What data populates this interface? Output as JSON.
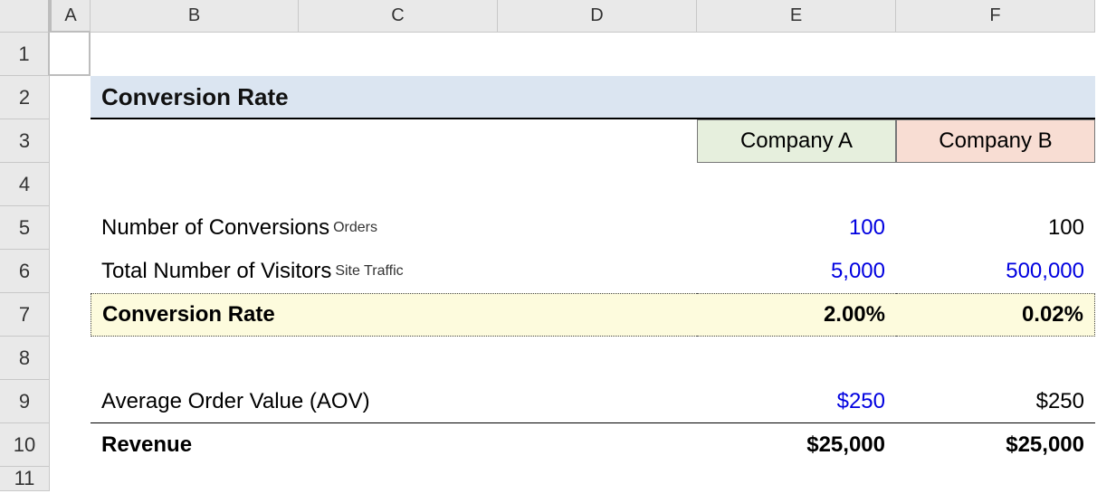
{
  "columns": [
    "A",
    "B",
    "C",
    "D",
    "E",
    "F"
  ],
  "rows": [
    "1",
    "2",
    "3",
    "4",
    "5",
    "6",
    "7",
    "8",
    "9",
    "10",
    "11"
  ],
  "title": "Conversion Rate",
  "headers": {
    "companyA": "Company A",
    "companyB": "Company B"
  },
  "labels": {
    "numConversions": "Number of Conversions",
    "numConversionsSub": "Orders",
    "totalVisitors": "Total Number of Visitors",
    "totalVisitorsSub": "Site Traffic",
    "conversionRate": "Conversion Rate",
    "aov": "Average Order Value (AOV)",
    "revenue": "Revenue"
  },
  "values": {
    "A": {
      "conversions": "100",
      "visitors": "5,000",
      "rate": "2.00%",
      "aov": "$250",
      "revenue": "$25,000"
    },
    "B": {
      "conversions": "100",
      "visitors": "500,000",
      "rate": "0.02%",
      "aov": "$250",
      "revenue": "$25,000"
    }
  }
}
